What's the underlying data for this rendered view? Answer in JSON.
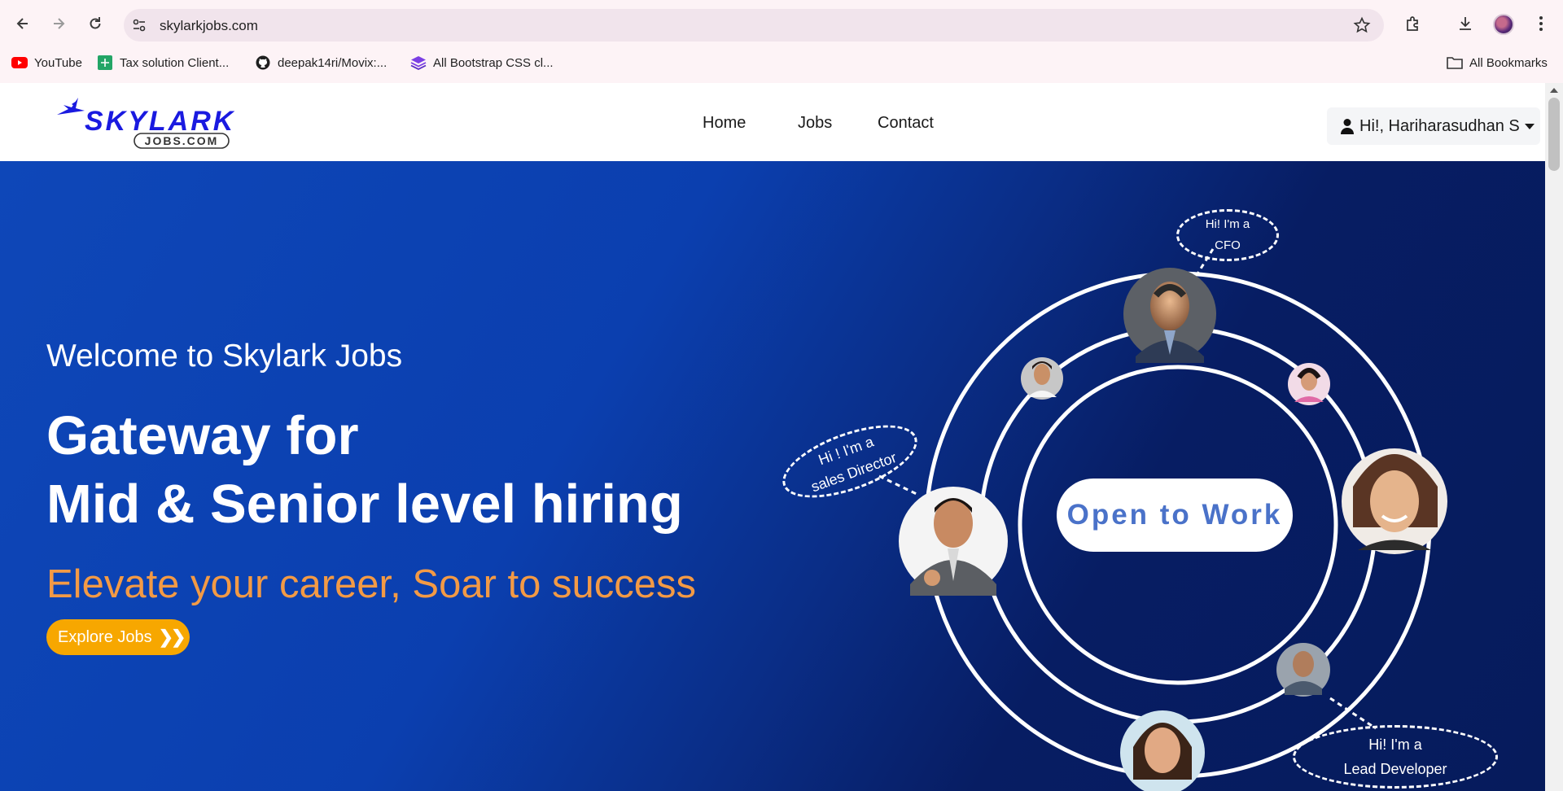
{
  "browser": {
    "url": "skylarkjobs.com",
    "bookmarks": [
      {
        "label": "YouTube",
        "icon": "youtube-icon"
      },
      {
        "label": "Tax solution Client...",
        "icon": "sheets-icon"
      },
      {
        "label": "deepak14ri/Movix:...",
        "icon": "github-icon"
      },
      {
        "label": "All Bootstrap CSS cl...",
        "icon": "layers-icon"
      }
    ],
    "all_bookmarks_label": "All Bookmarks"
  },
  "site": {
    "logo_text": "SKYLARK",
    "logo_sub": "JOBS.COM",
    "nav": [
      "Home",
      "Jobs",
      "Contact"
    ],
    "user_greeting": "Hi!, Hariharasudhan S"
  },
  "hero": {
    "welcome": "Welcome to Skylark Jobs",
    "headline_1": "Gateway for",
    "headline_2": "Mid & Senior level hiring",
    "tagline": "Elevate your career, Soar to success",
    "cta": "Explore Jobs",
    "open_to_work": "Open to Work",
    "bubble_cfo_1": "Hi! I'm a",
    "bubble_cfo_2": "CFO",
    "bubble_sales_1": "Hi ! I'm a",
    "bubble_sales_2": "sales Director",
    "bubble_dev_1": "Hi! I'm a",
    "bubble_dev_2": "Lead Developer"
  },
  "colors": {
    "hero_blue": "#0b3faf",
    "hero_navy": "#061b5c",
    "cta_orange": "#f7a700",
    "tagline_orange": "#f39a45",
    "open_text_blue": "#4a72c9",
    "logo_blue": "#1a1ae0"
  }
}
